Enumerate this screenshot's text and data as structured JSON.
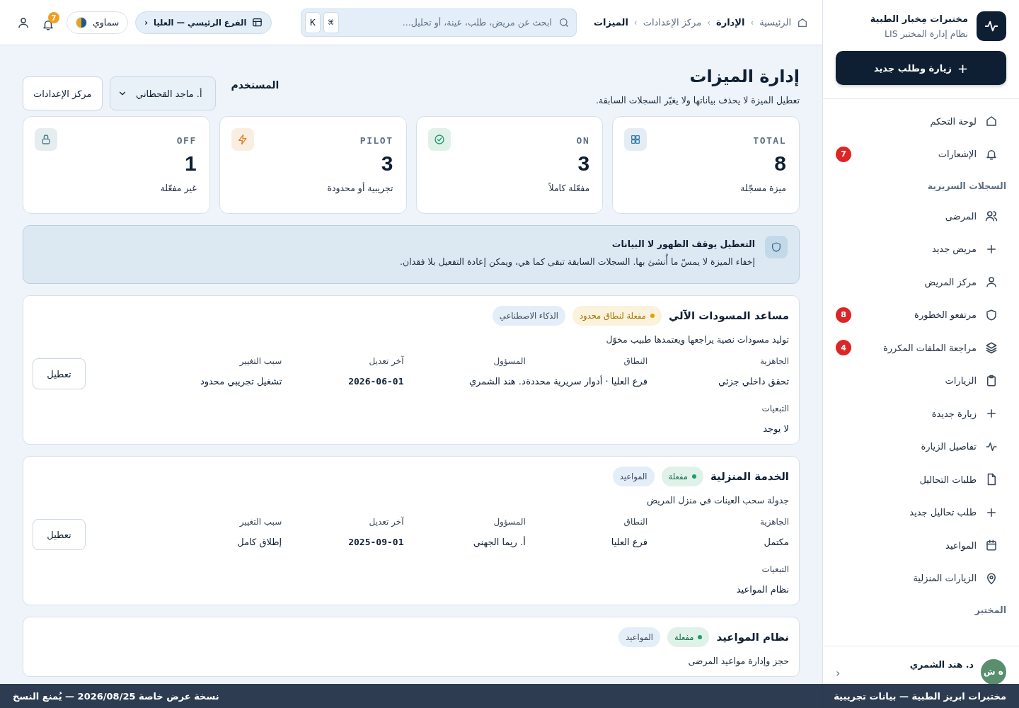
{
  "sidebar": {
    "brand": {
      "name": "مختبرات مِخبار الطبية",
      "subtitle": "نظام إدارة المختبر LIS"
    },
    "new_button": {
      "icon": "+",
      "label": "زيارة وطلب جديد"
    },
    "sections": [
      {
        "items": [
          {
            "label": "لوحة التحكم",
            "selected": false
          },
          {
            "label": "الإشعارات",
            "badge": "7",
            "selected": false
          }
        ]
      },
      {
        "title": "السجلات السريرية",
        "items": [
          {
            "label": "المرضى",
            "selected": false
          },
          {
            "label": "مريض جديد",
            "selected": false
          },
          {
            "label": "مركز المريض",
            "selected": false
          },
          {
            "label": "مرتفعو الخطورة",
            "badge": "8",
            "selected": false
          },
          {
            "label": "مراجعة الملفات المكررة",
            "badge": "4",
            "selected": false
          },
          {
            "label": "الزيارات",
            "selected": false
          },
          {
            "label": "زيارة جديدة",
            "selected": false
          },
          {
            "label": "تفاصيل الزيارة",
            "selected": false
          },
          {
            "label": "طلبات التحاليل",
            "selected": false
          },
          {
            "label": "طلب تحاليل جديد",
            "selected": false
          },
          {
            "label": "المواعيد",
            "selected": false
          },
          {
            "label": "الزيارات المنزلية",
            "selected": false
          }
        ]
      },
      {
        "title": "المختبر"
      }
    ],
    "user": {
      "initials": "ه ش",
      "name": "د. هند الشمري",
      "chevron": "‹"
    }
  },
  "topbar": {
    "breadcrumb_separator": "›",
    "breadcrumb": [
      {
        "label": "الرئيسية",
        "current": false
      },
      {
        "label": "الإدارة",
        "current": true
      },
      {
        "label": "مركز الإعدادات",
        "current": false
      },
      {
        "label": "الميزات",
        "current": true
      }
    ],
    "search": {
      "placeholder": "ابحث عن مريض، طلب، عينة، أو تحليل...",
      "keys": [
        "⌘",
        "K"
      ]
    },
    "branch": {
      "label": "الفرع الرئيسي — العليا",
      "chevron": "‹"
    },
    "theme": {
      "label": "سماوي"
    },
    "notifications": {
      "count": "7"
    }
  },
  "page": {
    "title": "إدارة الميزات",
    "subtitle": "تعطيل الميزة لا يحذف بياناتها ولا يغيّر السجلات السابقة.",
    "user_label": "المستخدم",
    "user_select": "أ. ماجد القحطاني",
    "settings_button": "مركز الإعدادات"
  },
  "stats": [
    {
      "label": "TOTAL",
      "value": "8",
      "caption": "ميزة مسجّلة",
      "color": "#3b7ea8"
    },
    {
      "label": "ON",
      "value": "3",
      "caption": "مفعّلة كاملاً",
      "color": "#1f9d6b"
    },
    {
      "label": "PILOT",
      "value": "3",
      "caption": "تجريبية أو محدودة",
      "color": "#d9822b"
    },
    {
      "label": "OFF",
      "value": "1",
      "caption": "غير مفعّلة",
      "color": "#4a7c8c"
    }
  ],
  "notice": {
    "title": "التعطيل يوقف الظهور لا البيانات",
    "text": "إخفاء الميزة لا يمسّ ما أُنشئ بها. السجلات السابقة تبقى كما هي، ويمكن إعادة التفعيل بلا فقدان."
  },
  "features": [
    {
      "name": "مساعد المسودات الآلي",
      "status": {
        "label": "مفعلة لنطاق محدود",
        "color": "#e0a100"
      },
      "tag": "الذكاء الاصطناعي",
      "description": "توليد مسودات نصية يراجعها ويعتمدها طبيب مخوّل",
      "fields": [
        {
          "label": "الجاهزية",
          "value": "تحقق داخلي جزئي"
        },
        {
          "label": "النطاق",
          "value": "فرع العليا · أدوار سريرية محددة"
        },
        {
          "label": "المسؤول",
          "value": "د. هند الشمري"
        },
        {
          "label": "آخر تعديل",
          "value": "2026-06-01"
        },
        {
          "label": "سبب التغيير",
          "value": "تشغيل تجريبي محدود"
        }
      ],
      "dependencies": {
        "label": "التبعيات",
        "value": "لا يوجد"
      },
      "button": "تعطيل"
    },
    {
      "name": "الخدمة المنزلية",
      "status": {
        "label": "مفعلة",
        "color": "#1f9d6b"
      },
      "tag": "المواعيد",
      "description": "جدولة سحب العينات في منزل المريض",
      "fields": [
        {
          "label": "الجاهزية",
          "value": "مكتمل"
        },
        {
          "label": "النطاق",
          "value": "فرع العليا"
        },
        {
          "label": "المسؤول",
          "value": "أ. ريما الجهني"
        },
        {
          "label": "آخر تعديل",
          "value": "2025-09-01"
        },
        {
          "label": "سبب التغيير",
          "value": "إطلاق كامل"
        }
      ],
      "dependencies": {
        "label": "التبعيات",
        "value": "نظام المواعيد"
      },
      "button": "تعطيل"
    },
    {
      "name": "نظام المواعيد",
      "status": {
        "label": "مفعلة",
        "color": "#1f9d6b"
      },
      "tag": "المواعيد",
      "description": "حجز وإدارة مواعيد المرضى"
    }
  ],
  "demo_banner": {
    "owner": "مختبرات ابريز الطبية — بيانات تجريبية",
    "notice": "نسخة عرض خاصة 2026/08/25 — يُمنع النسخ"
  }
}
